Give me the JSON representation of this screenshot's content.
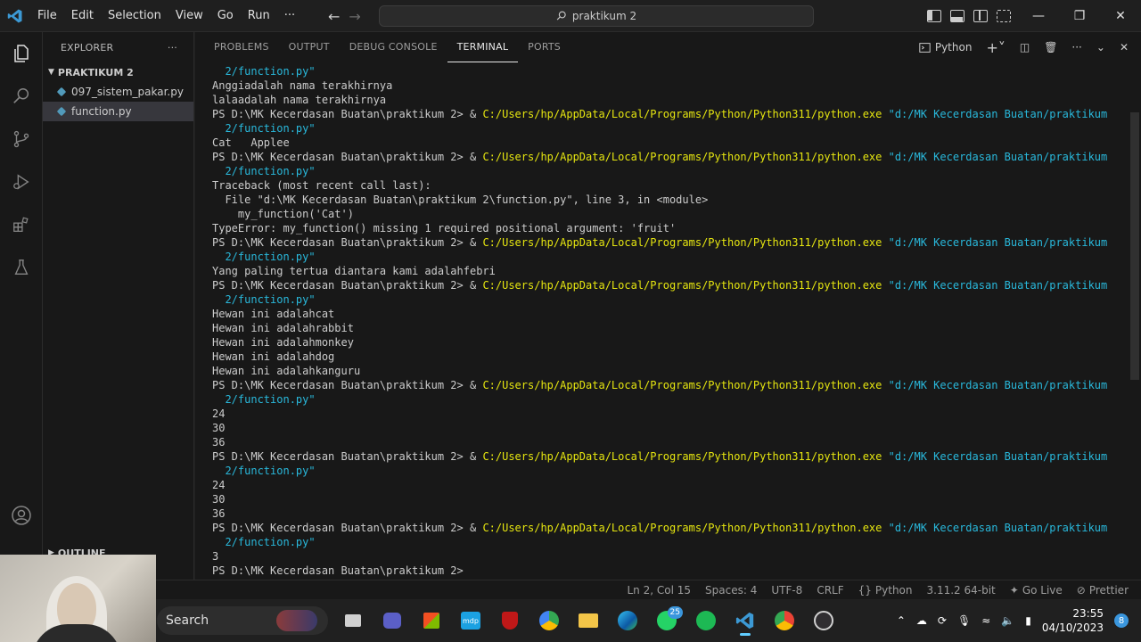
{
  "menu": [
    "File",
    "Edit",
    "Selection",
    "View",
    "Go",
    "Run",
    "···"
  ],
  "command_center": "praktikum 2",
  "explorer": {
    "title": "EXPLORER",
    "folder": "PRAKTIKUM 2",
    "files": [
      "097_sistem_pakar.py",
      "function.py"
    ],
    "active_file": "function.py",
    "outline": "OUTLINE"
  },
  "panel": {
    "tabs": [
      "PROBLEMS",
      "OUTPUT",
      "DEBUG CONSOLE",
      "TERMINAL",
      "PORTS"
    ],
    "active_tab": "TERMINAL",
    "shell_label": "Python"
  },
  "terminal": {
    "prompt": "PS D:\\MK Kecerdasan Buatan\\praktikum 2> & ",
    "exe": "C:/Users/hp/AppData/Local/Programs/Python/Python311/python.exe",
    "arg_start": " \"d:/MK Kecerdasan Buatan/praktikum",
    "arg_end": "  2/function.py\"",
    "lines": [
      {
        "t": "argend"
      },
      {
        "t": "out",
        "text": "Anggiadalah nama terakhirnya"
      },
      {
        "t": "out",
        "text": "lalaadalah nama terakhirnya"
      },
      {
        "t": "cmd"
      },
      {
        "t": "argend"
      },
      {
        "t": "out",
        "text": "Cat   Applee"
      },
      {
        "t": "cmd"
      },
      {
        "t": "argend"
      },
      {
        "t": "out",
        "text": "Traceback (most recent call last):"
      },
      {
        "t": "out",
        "text": "  File \"d:\\MK Kecerdasan Buatan\\praktikum 2\\function.py\", line 3, in <module>"
      },
      {
        "t": "out",
        "text": "    my_function('Cat')"
      },
      {
        "t": "out",
        "text": "TypeError: my_function() missing 1 required positional argument: 'fruit'"
      },
      {
        "t": "cmd"
      },
      {
        "t": "argend"
      },
      {
        "t": "out",
        "text": "Yang paling tertua diantara kami adalahfebri"
      },
      {
        "t": "cmd"
      },
      {
        "t": "argend"
      },
      {
        "t": "out",
        "text": "Hewan ini adalahcat"
      },
      {
        "t": "out",
        "text": "Hewan ini adalahrabbit"
      },
      {
        "t": "out",
        "text": "Hewan ini adalahmonkey"
      },
      {
        "t": "out",
        "text": "Hewan ini adalahdog"
      },
      {
        "t": "out",
        "text": "Hewan ini adalahkanguru"
      },
      {
        "t": "cmd"
      },
      {
        "t": "argend"
      },
      {
        "t": "out",
        "text": "24"
      },
      {
        "t": "out",
        "text": "30"
      },
      {
        "t": "out",
        "text": "36"
      },
      {
        "t": "cmd"
      },
      {
        "t": "argend"
      },
      {
        "t": "out",
        "text": "24"
      },
      {
        "t": "out",
        "text": "30"
      },
      {
        "t": "out",
        "text": "36"
      },
      {
        "t": "cmd"
      },
      {
        "t": "argend"
      },
      {
        "t": "out",
        "text": "3"
      },
      {
        "t": "prompt",
        "text": "PS D:\\MK Kecerdasan Buatan\\praktikum 2> "
      }
    ]
  },
  "status": {
    "position": "Ln 2, Col 15",
    "spaces": "Spaces: 4",
    "encoding": "UTF-8",
    "eol": "CRLF",
    "language": "Python",
    "interpreter": "3.11.2 64-bit",
    "golive": "Go Live",
    "prettier": "Prettier"
  },
  "taskbar": {
    "search": "Search",
    "whatsapp_badge": "25",
    "time": "23:55",
    "date": "04/10/2023",
    "notif": "8"
  },
  "colors": {
    "exe": "#e5e510",
    "string": "#29b8db",
    "vscode_blue": "#3c99d4"
  }
}
